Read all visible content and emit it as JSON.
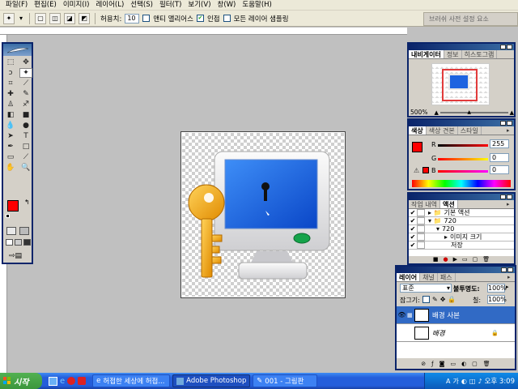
{
  "menu": [
    "파일(F)",
    "편집(E)",
    "이미지(I)",
    "레이어(L)",
    "선택(S)",
    "필터(T)",
    "보기(V)",
    "창(W)",
    "도움말(H)"
  ],
  "options": {
    "tolerance_label": "허용치:",
    "tolerance_value": "10",
    "antialias_label": "앤티 앨리어스",
    "contiguous_label": "인접",
    "sample_all_label": "모든 레이어 샘플링",
    "palette_well": "브러쉬 사전 설정 요소"
  },
  "navigator": {
    "tabs": [
      "내비게이터",
      "정보",
      "히스토그램"
    ],
    "zoom": "500%"
  },
  "color": {
    "tabs": [
      "색상",
      "색상 견본",
      "스타일"
    ],
    "r_label": "R",
    "r_value": "255",
    "g_label": "G",
    "g_value": "0",
    "b_label": "B",
    "b_value": "0",
    "foreground": "#ff0000"
  },
  "actions": {
    "tabs": [
      "작업 내역",
      "액션"
    ],
    "rows": [
      "기본 액션",
      "720",
      "720",
      "이미지 크기",
      "저장"
    ]
  },
  "layers": {
    "tabs": [
      "레이어",
      "채널",
      "패스"
    ],
    "blend_mode": "표준",
    "opacity_label": "불투명도:",
    "opacity_value": "100%",
    "lock_label": "잠그기:",
    "fill_label": "칠:",
    "fill_value": "100%",
    "items": [
      {
        "name": "배경 사본",
        "selected": true
      },
      {
        "name": "배경",
        "selected": false
      }
    ]
  },
  "taskbar": {
    "start": "시작",
    "tasks": [
      "허접한 세상에 허접...",
      "Adobe Photoshop",
      "001 - 그림판"
    ],
    "clock": "오후 3:09"
  }
}
